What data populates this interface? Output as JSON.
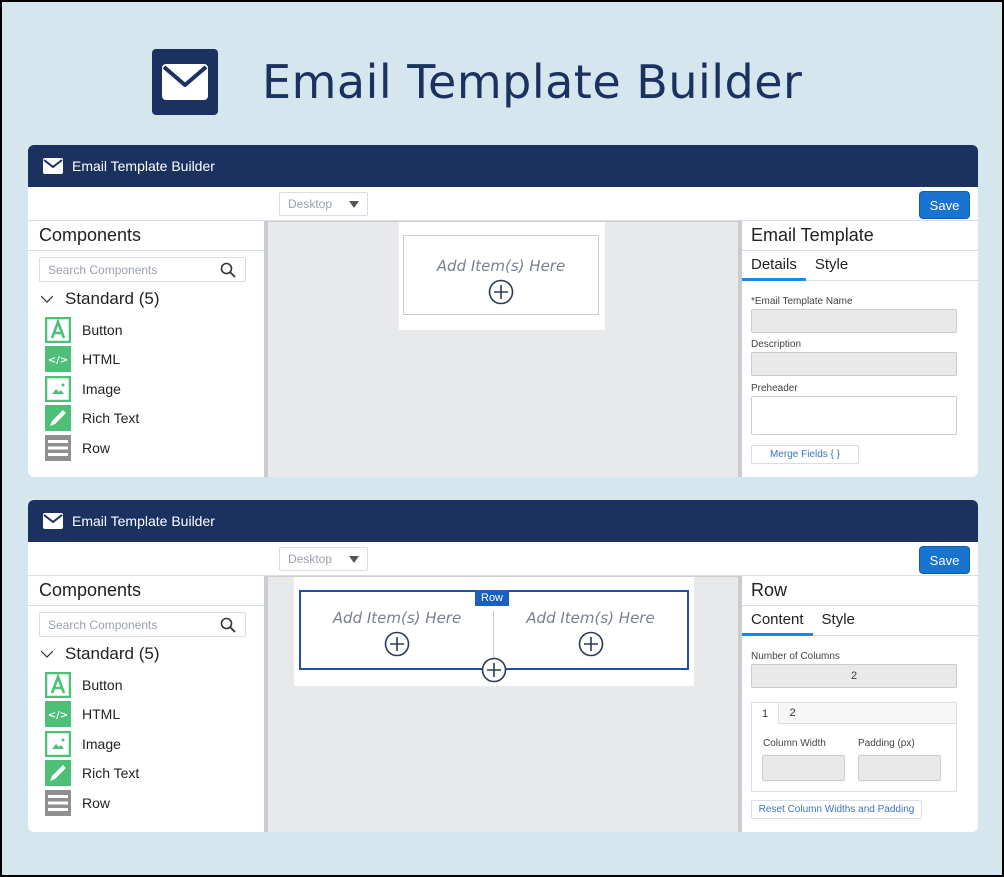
{
  "hero": {
    "title": "Email Template Builder",
    "icon": "envelope-icon"
  },
  "colors": {
    "navy": "#1b3160",
    "save_blue": "#1874d0",
    "tab_blue": "#1589ee",
    "green_icon": "#4bc076",
    "row_blue": "#1c4fae",
    "background": "#d6e6ee"
  },
  "panels": [
    {
      "header": {
        "title": "Email Template Builder",
        "icon": "envelope-icon"
      },
      "toolbar": {
        "device_select": "Desktop",
        "save_label": "Save"
      },
      "left": {
        "title": "Components",
        "search_placeholder": "Search Components",
        "group": "Standard (5)",
        "items": [
          {
            "label": "Button",
            "icon": "button-icon"
          },
          {
            "label": "HTML",
            "icon": "html-icon"
          },
          {
            "label": "Image",
            "icon": "image-icon"
          },
          {
            "label": "Rich Text",
            "icon": "rich-text-icon"
          },
          {
            "label": "Row",
            "icon": "row-icon"
          }
        ]
      },
      "canvas": {
        "dropzones": [
          "Add Item(s) Here"
        ]
      },
      "right": {
        "title": "Email Template",
        "tabs": [
          "Details",
          "Style"
        ],
        "active_tab": "Details",
        "fields": [
          {
            "label": "*Email Template Name",
            "value": ""
          },
          {
            "label": "Description",
            "value": ""
          },
          {
            "label": "Preheader",
            "value": ""
          }
        ],
        "merge_button": "Merge Fields { }"
      }
    },
    {
      "header": {
        "title": "Email Template Builder",
        "icon": "envelope-icon"
      },
      "toolbar": {
        "device_select": "Desktop",
        "save_label": "Save"
      },
      "left": {
        "title": "Components",
        "search_placeholder": "Search Components",
        "group": "Standard (5)",
        "items": [
          {
            "label": "Button",
            "icon": "button-icon"
          },
          {
            "label": "HTML",
            "icon": "html-icon"
          },
          {
            "label": "Image",
            "icon": "image-icon"
          },
          {
            "label": "Rich Text",
            "icon": "rich-text-icon"
          },
          {
            "label": "Row",
            "icon": "row-icon"
          }
        ]
      },
      "canvas": {
        "row_tag": "Row",
        "dropzones": [
          "Add Item(s) Here",
          "Add Item(s) Here"
        ]
      },
      "right": {
        "title": "Row",
        "tabs": [
          "Content",
          "Style"
        ],
        "active_tab": "Content",
        "num_columns_label": "Number of Columns",
        "num_columns_value": "2",
        "column_tabs": [
          "1",
          "2"
        ],
        "active_column_tab": "1",
        "column_width_label": "Column Width",
        "column_width_value": "",
        "padding_label": "Padding (px)",
        "padding_value": "",
        "reset_button": "Reset Column Widths and Padding"
      }
    }
  ]
}
